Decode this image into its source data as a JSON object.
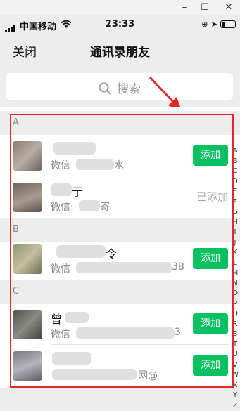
{
  "window": {
    "minimize": "–",
    "maximize": "☐",
    "close": "✕"
  },
  "status_bar": {
    "carrier": "中国移动",
    "time": "23:33"
  },
  "nav": {
    "close_label": "关闭",
    "title": "通讯录朋友"
  },
  "search": {
    "placeholder": "搜索"
  },
  "sections": [
    {
      "letter": "A",
      "contacts": [
        {
          "name": "",
          "wechat_prefix": "微信",
          "wechat_tail": "水",
          "action": "添加",
          "added": false
        },
        {
          "name": "亍",
          "wechat_prefix": "微信:",
          "wechat_tail": "寄",
          "action": "已添加",
          "added": true
        }
      ]
    },
    {
      "letter": "B",
      "contacts": [
        {
          "name": "令",
          "wechat_prefix": "微信",
          "wechat_tail": "38",
          "action": "添加",
          "added": false
        }
      ]
    },
    {
      "letter": "C",
      "contacts": [
        {
          "name": "曾",
          "wechat_prefix": "微信",
          "wechat_tail": "3",
          "action": "添加",
          "added": false
        },
        {
          "name": "",
          "wechat_prefix": "",
          "wechat_tail": "网@",
          "action": "添加",
          "added": false
        }
      ]
    }
  ],
  "index_letters": [
    "A",
    "B",
    "C",
    "D",
    "E",
    "F",
    "G",
    "H",
    "I",
    "J",
    "K",
    "L",
    "M",
    "N",
    "O",
    "P",
    "Q",
    "R",
    "S",
    "T",
    "U",
    "V",
    "W",
    "X",
    "Y",
    "Z"
  ],
  "colors": {
    "accent": "#07c160",
    "highlight": "#e02a2a"
  }
}
